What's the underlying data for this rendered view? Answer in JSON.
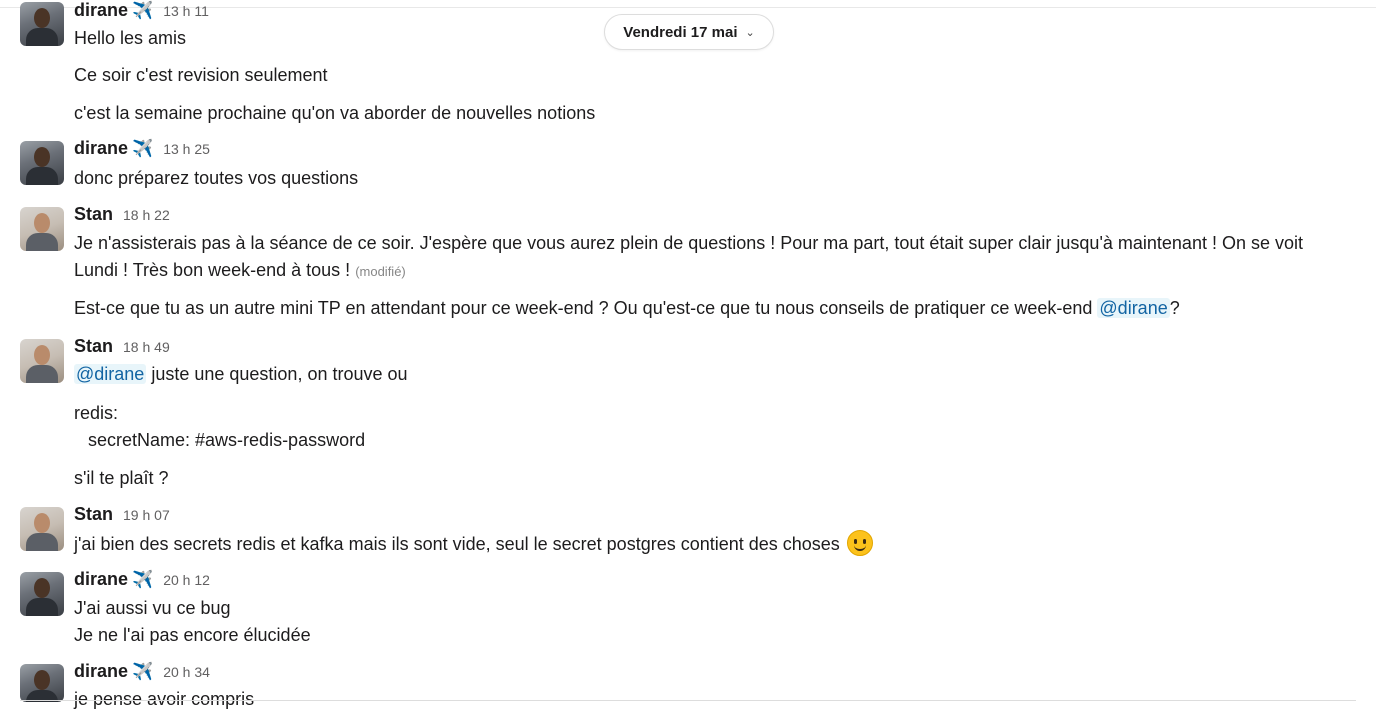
{
  "date_divider": {
    "label": "Vendredi 17 mai"
  },
  "messages": [
    {
      "author": "dirane",
      "status_icon": "airplane-icon",
      "time": "13 h 11",
      "lines": [
        "Hello les amis",
        "Ce soir c'est revision seulement",
        "c'est la semaine prochaine qu'on va aborder de nouvelles notions"
      ]
    },
    {
      "author": "dirane",
      "status_icon": "airplane-icon",
      "time": "13 h 25",
      "lines": [
        "donc préparez toutes vos questions"
      ]
    },
    {
      "author": "Stan",
      "time": "18 h 22",
      "lines": [
        "Je n'assisterais pas à la séance de ce soir. J'espère que vous aurez plein de questions ! Pour ma part, tout était super clair jusqu'à maintenant ! On se voit",
        "Lundi ! Très bon week-end à tous !",
        "Est-ce que tu as un autre mini TP en attendant pour ce week-end ? Ou qu'est-ce que tu nous conseils de pratiquer ce week-end"
      ],
      "edited_label": "(modifié)",
      "mention": "@dirane",
      "after_mention": "?"
    },
    {
      "author": "Stan",
      "time": "18 h 49",
      "mention": "@dirane",
      "lines": [
        "juste une question, on trouve ou",
        "redis:",
        "secretName: #aws-redis-password",
        "s'il te plaît ?"
      ]
    },
    {
      "author": "Stan",
      "time": "19 h 07",
      "lines": [
        "j'ai bien des secrets redis et kafka mais ils sont vide, seul le secret postgres contient des choses"
      ],
      "emoji": "slightly-smiling-face-icon"
    },
    {
      "author": "dirane",
      "status_icon": "airplane-icon",
      "time": "20 h 12",
      "lines": [
        "J'ai aussi vu ce bug",
        "Je ne l'ai pas encore élucidée"
      ]
    },
    {
      "author": "dirane",
      "status_icon": "airplane-icon",
      "time": "20 h 34",
      "lines": [
        "je pense avoir compris"
      ]
    }
  ]
}
